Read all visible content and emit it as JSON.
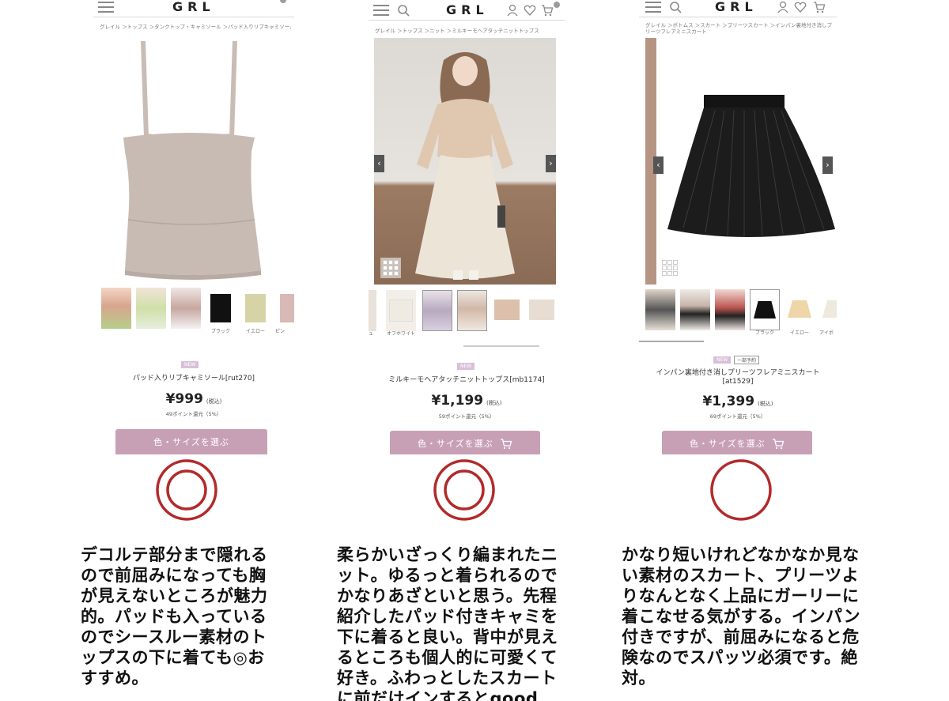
{
  "accent_color": "#c8a0b6",
  "rating_color": "#b22a2a",
  "products": [
    {
      "logo": "GRL",
      "breadcrumb": "グレイル ＞トップス ＞タンクトップ・キャミソール ＞パッド入りリブキャミソール",
      "new_label": "NEW",
      "reserve_label": "",
      "name": "パッド入りリブキャミソール[rut270]",
      "price": "¥999",
      "tax": "(税込)",
      "points": "49ポイント還元（5%）",
      "button": "色・サイズを選ぶ",
      "thumb_labels": [
        "",
        "",
        "",
        "ブラック",
        "イエロー",
        "ピン"
      ],
      "rating": "double-circle",
      "comment": "デコルテ部分まで隠れるので前屈みになっても胸が見えないところが魅力的。パッドも入っているのでシースルー素材のトップスの下に着ても◎おすすめ。",
      "comment_lines": [
        "デコルテ部分まで隠れる",
        "ので前屈みになっても胸",
        "が見えないところが魅力",
        "的。パッドも入っている",
        "のでシースルー素材のト",
        "ップスの下に着ても◎お",
        "すすめ。"
      ]
    },
    {
      "logo": "GRL",
      "breadcrumb": "グレイル ＞トップス ＞ニット ＞ミルキーモヘアタッチニットトップス",
      "new_label": "NEW",
      "reserve_label": "",
      "name": "ミルキーモヘアタッチニットトップス[mb1174]",
      "price": "¥1,199",
      "tax": "(税込)",
      "points": "59ポイント還元（5%）",
      "button": "色・サイズを選ぶ",
      "thumb_labels": [
        "ジュ",
        "オフホワイト",
        "",
        "",
        "",
        ""
      ],
      "rating": "double-circle",
      "comment_lines": [
        "柔らかいざっくり編まれたニ",
        "ット。ゆるっと着られるので",
        "かなりあざといと思う。先程",
        "紹介したパッド付きキャミを",
        "下に着ると良い。背中が見え",
        "るところも個人的に可愛くて",
        "好き。ふわっとしたスカート",
        "に前だけインするとgood"
      ]
    },
    {
      "logo": "GRL",
      "breadcrumb": "グレイル ＞ボトムス ＞スカート ＞プリーツスカート ＞インパン裏地付き消しプリーツフレアミニスカート",
      "new_label": "NEW",
      "reserve_label": "一部予約",
      "name": "インパン裏地付き消しプリーツフレアミニスカート",
      "code": "[at1529]",
      "price": "¥1,399",
      "tax": "(税込)",
      "points": "69ポイント還元（5%）",
      "button": "色・サイズを選ぶ",
      "thumb_labels": [
        "",
        "",
        "",
        "ブラック",
        "イエロー",
        "アイボ"
      ],
      "rating": "single-circle",
      "comment_lines": [
        "かなり短いけれどなかなか見な",
        "い素材のスカート、プリーツよ",
        "りなんとなく上品にガーリーに",
        "着こなせる気がする。インパン",
        "付きですが、前屈みになると危",
        "険なのでスパッツ必須です。絶",
        "対。"
      ]
    }
  ]
}
